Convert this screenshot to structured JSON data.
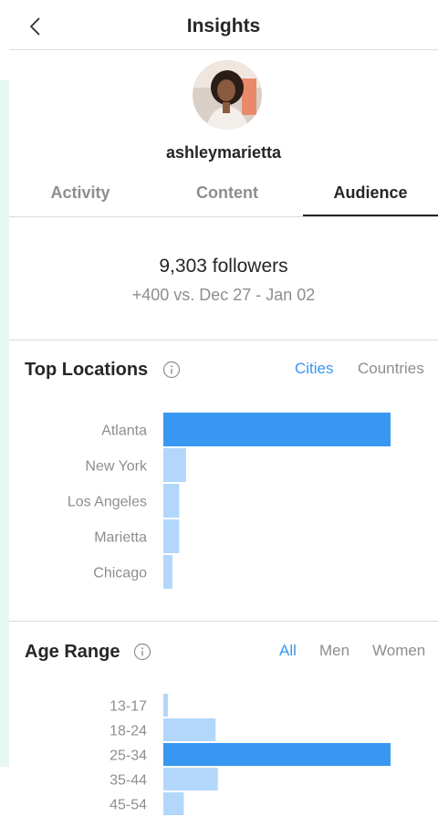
{
  "header": {
    "title": "Insights"
  },
  "profile": {
    "username": "ashleymarietta"
  },
  "tabs": [
    {
      "label": "Activity"
    },
    {
      "label": "Content"
    },
    {
      "label": "Audience"
    }
  ],
  "audience": {
    "followers": "9,303 followers",
    "delta": "+400 vs. Dec 27 - Jan 02"
  },
  "top_locations": {
    "title": "Top Locations",
    "filters": [
      "Cities",
      "Countries"
    ],
    "active_filter": "Cities"
  },
  "age_range": {
    "title": "Age Range",
    "filters": [
      "All",
      "Men",
      "Women"
    ],
    "active_filter": "All"
  },
  "colors": {
    "accent": "#3897f0",
    "bar_primary": "#3897f0",
    "bar_secondary": "#b3d7fb"
  },
  "chart_data": [
    {
      "type": "bar",
      "orientation": "horizontal",
      "categories": [
        "Atlanta",
        "New York",
        "Los Angeles",
        "Marietta",
        "Chicago"
      ],
      "values": [
        100,
        10,
        7,
        7,
        4
      ]
    },
    {
      "type": "bar",
      "orientation": "horizontal",
      "categories": [
        "13-17",
        "18-24",
        "25-34",
        "35-44",
        "45-54"
      ],
      "values": [
        2,
        23,
        100,
        24,
        9
      ]
    }
  ]
}
